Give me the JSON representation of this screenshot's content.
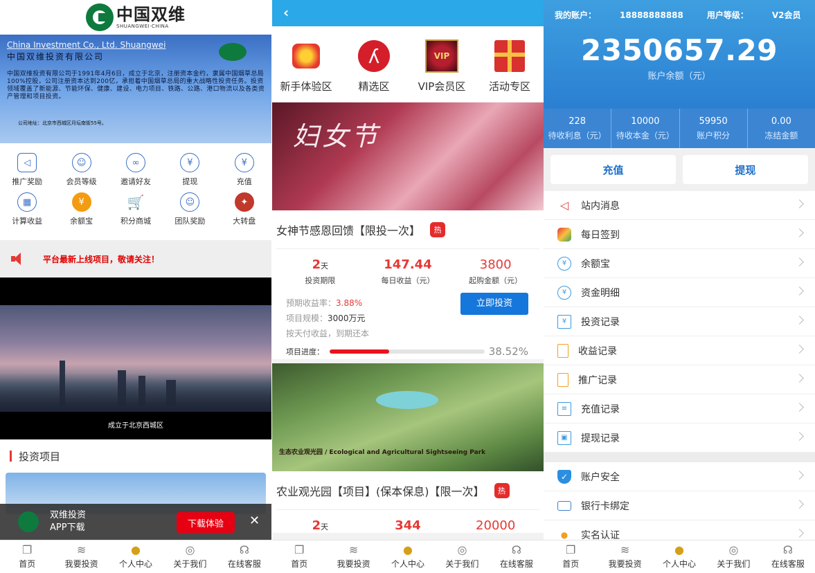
{
  "panel1": {
    "logo": {
      "cn": "中国双维",
      "en": "SHUANGWEI·CHINA"
    },
    "banner": {
      "en_title": "China Investment Co., Ltd. Shuangwei",
      "cn_title": "中国双维投资有限公司",
      "body": "中国双维投资有限公司于1991年4月6日，成立于北京，注册资本金约，隶属中国烟草总局100%控股，公司注册资本达到200亿，承担着中国烟草总局的重大战略性投资任务。投资领域覆盖了新能源、节能环保、健康、建设、电力项目、铁路、公路、港口物流以及各类资产管理和项目投资。",
      "address": "公司地址：北京市西城区月坛南街55号。"
    },
    "icons": [
      {
        "label": "推广奖励",
        "glyph": "◁"
      },
      {
        "label": "会员等级",
        "glyph": "☺"
      },
      {
        "label": "邀请好友",
        "glyph": "∞"
      },
      {
        "label": "提现",
        "glyph": "¥"
      },
      {
        "label": "充值",
        "glyph": "¥"
      },
      {
        "label": "计算收益",
        "glyph": "▦"
      },
      {
        "label": "余额宝",
        "glyph": "¥"
      },
      {
        "label": "积分商城",
        "glyph": "🛒"
      },
      {
        "label": "团队奖励",
        "glyph": "☺"
      },
      {
        "label": "大转盘",
        "glyph": "✦"
      }
    ],
    "notice": "平台最新上线项目，敬请关注！",
    "video_caption": "成立于北京西城区",
    "section_title": "投资项目",
    "app_banner": {
      "line1": "双维投资",
      "line2": "APP下载",
      "button": "下载体验",
      "close": "✕"
    }
  },
  "panel2": {
    "back": "‹",
    "categories": [
      {
        "label": "新手体验区"
      },
      {
        "label": "精选区"
      },
      {
        "label": "VIP会员区",
        "badge": "VIP"
      },
      {
        "label": "活动专区"
      }
    ],
    "promo1_title": "妇女节",
    "product1": {
      "name": "女神节感恩回馈【限投一次】",
      "hot": "热",
      "days": "2",
      "days_unit": "天",
      "days_label": "投资期限",
      "daily": "147.44",
      "daily_label": "每日收益（元）",
      "min": "3800",
      "min_label": "起购金额（元）",
      "rate_label": "预期收益率：",
      "rate": "3.88%",
      "scale_label": "项目规模：",
      "scale": "3000万元",
      "payout": "按天付收益，到期还本",
      "button": "立即投资",
      "progress_label": "项目进度：",
      "progress_pct": "38.52%",
      "progress": 0.3852
    },
    "promo2_caption": "生态农业观光园 / Ecological and Agricultural Sightseeing Park",
    "product2": {
      "name": "农业观光园【项目】(保本保息)【限一次】",
      "hot": "热",
      "days": "2",
      "days_unit": "天",
      "daily": "344",
      "min": "20000"
    }
  },
  "panel3": {
    "account_label": "我的账户：",
    "account": "18888888888",
    "level_label": "用户等级：",
    "level": "V2会员",
    "balance": "2350657.29",
    "balance_label": "账户余额（元）",
    "stats": [
      {
        "v": "228",
        "l": "待收利息（元）"
      },
      {
        "v": "10000",
        "l": "待收本金（元）"
      },
      {
        "v": "59950",
        "l": "账户积分"
      },
      {
        "v": "0.00",
        "l": "冻结金额"
      }
    ],
    "recharge": "充值",
    "withdraw": "提现",
    "menu1": [
      "站内消息",
      "每日签到",
      "余额宝",
      "资金明细",
      "投资记录",
      "收益记录",
      "推广记录",
      "充值记录",
      "提现记录"
    ],
    "menu2": [
      "账户安全",
      "银行卡绑定",
      "实名认证"
    ]
  },
  "tabbar": [
    "首页",
    "我要投资",
    "个人中心",
    "关于我们",
    "在线客服"
  ]
}
